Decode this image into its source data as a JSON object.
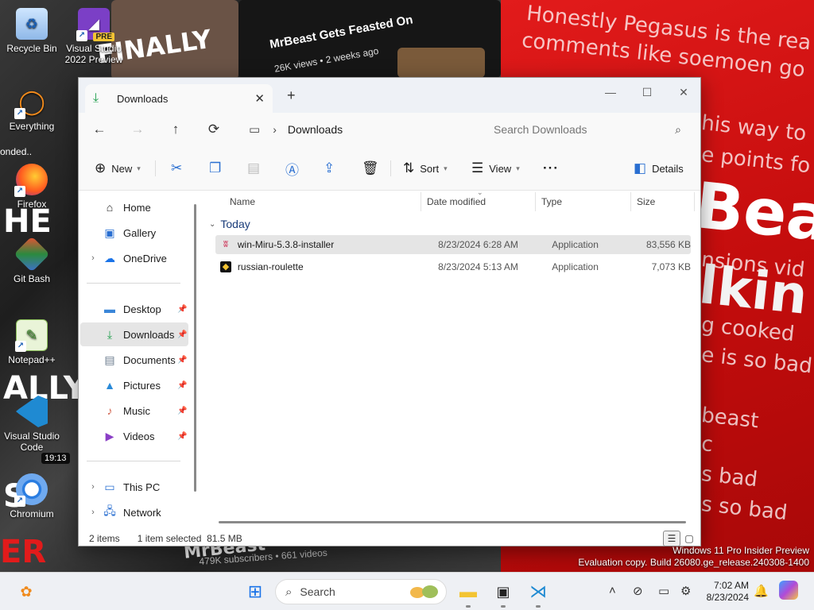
{
  "desktop": {
    "icons": [
      {
        "label": "Recycle Bin",
        "icon": "recycle-bin-icon"
      },
      {
        "label": "Visual Studio 2022 Preview",
        "icon": "visual-studio-preview-icon",
        "badge": "PRE"
      },
      {
        "label": "Everything",
        "icon": "everything-search-icon"
      },
      {
        "label": "Firefox",
        "icon": "firefox-icon"
      },
      {
        "label": "Git Bash",
        "icon": "git-bash-icon"
      },
      {
        "label": "Notepad++",
        "icon": "notepadpp-icon"
      },
      {
        "label": "Visual Studio Code",
        "icon": "vscode-icon"
      },
      {
        "label": "Chromium",
        "icon": "chromium-icon"
      }
    ],
    "wallpaper": {
      "video_title": "MrBeast Gets Feasted On",
      "video_meta": "26K views • 2 weeks ago",
      "duration_badge": "19:13",
      "comments": [
        "Honestly Pegasus is the rea",
        "comments like soemoen go",
        "his way to",
        "e points fo",
        "nsions vid",
        "g cooked",
        "e is so bad",
        "beast",
        "c",
        "s bad",
        "s so bad"
      ],
      "big_text": "Bea",
      "big_text_red": "lkin",
      "left_words": [
        "FINALLY",
        "onded..",
        "HE",
        "ALLY",
        "S",
        "ER"
      ],
      "channel_meta": "479K subscribers • 661 videos",
      "channel_name": "MrBeast"
    }
  },
  "explorer": {
    "tab": {
      "label": "Downloads"
    },
    "address": {
      "crumb": "Downloads"
    },
    "search": {
      "placeholder": "Search Downloads"
    },
    "toolbar": {
      "new_label": "New",
      "sort_label": "Sort",
      "view_label": "View",
      "details_label": "Details"
    },
    "sidebar": {
      "items": [
        {
          "label": "Home",
          "icon": "home-icon"
        },
        {
          "label": "Gallery",
          "icon": "gallery-icon"
        },
        {
          "label": "OneDrive",
          "icon": "onedrive-icon"
        },
        {
          "label": "Desktop",
          "icon": "desktop-folder-icon",
          "pinned": true
        },
        {
          "label": "Downloads",
          "icon": "downloads-folder-icon",
          "pinned": true,
          "selected": true
        },
        {
          "label": "Documents",
          "icon": "documents-folder-icon",
          "pinned": true
        },
        {
          "label": "Pictures",
          "icon": "pictures-folder-icon",
          "pinned": true
        },
        {
          "label": "Music",
          "icon": "music-folder-icon",
          "pinned": true
        },
        {
          "label": "Videos",
          "icon": "videos-folder-icon",
          "pinned": true
        },
        {
          "label": "This PC",
          "icon": "this-pc-icon"
        },
        {
          "label": "Network",
          "icon": "network-icon"
        }
      ]
    },
    "columns": {
      "name": "Name",
      "date": "Date modified",
      "type": "Type",
      "size": "Size"
    },
    "group": {
      "label": "Today"
    },
    "files": [
      {
        "name": "win-Miru-5.3.8-installer",
        "date": "8/23/2024 6:28 AM",
        "type": "Application",
        "size": "83,556 KB",
        "selected": true,
        "icon": "miru-app-icon"
      },
      {
        "name": "russian-roulette",
        "date": "8/23/2024 5:13 AM",
        "type": "Application",
        "size": "7,073 KB",
        "selected": false,
        "icon": "roulette-app-icon"
      }
    ],
    "status": {
      "count": "2 items",
      "selection": "1 item selected  81.5 MB"
    }
  },
  "watermark": {
    "line1": "Windows 11 Pro Insider Preview",
    "line2": "Evaluation copy. Build 26080.ge_release.240308-1400"
  },
  "taskbar": {
    "search_label": "Search",
    "time": "7:02 AM",
    "date": "8/23/2024"
  },
  "colors": {
    "accent": "#2a6fd1",
    "wallpaper_red": "#e21b1b",
    "selection": "#e5e5e5",
    "downloads_green": "#1f9e4c"
  }
}
